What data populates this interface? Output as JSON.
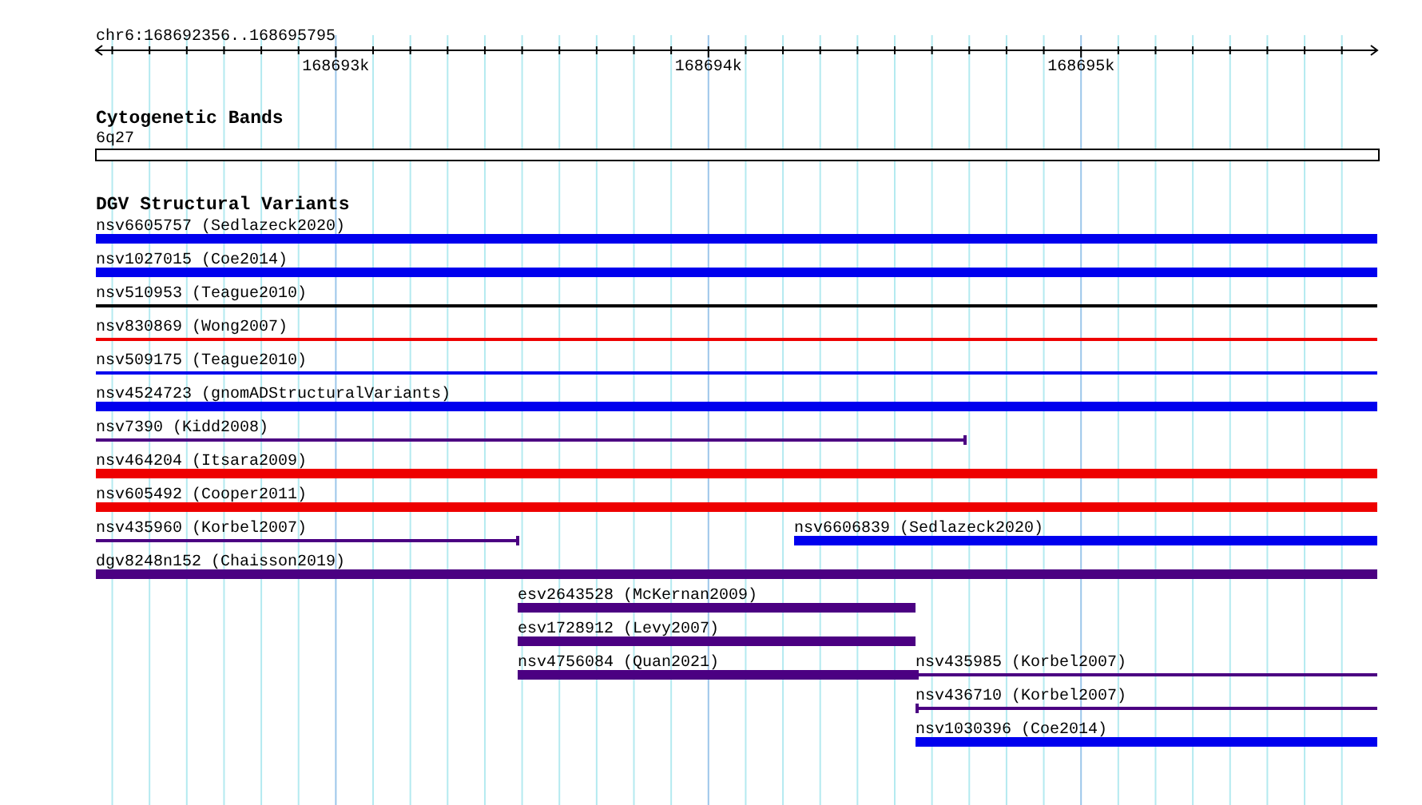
{
  "ruler": {
    "location": "chr6:168692356..168695795",
    "major_labels": [
      "168693k",
      "168694k",
      "168695k"
    ]
  },
  "cytogenetic_track": {
    "title": "Cytogenetic Bands",
    "band": "6q27"
  },
  "dgv_track": {
    "title": "DGV Structural Variants",
    "rows": [
      {
        "features": [
          {
            "label": "nsv6605757 (Sedlazeck2020)",
            "kind": "thick",
            "color": "#0000ee"
          }
        ]
      },
      {
        "features": [
          {
            "label": "nsv1027015 (Coe2014)",
            "kind": "thick",
            "color": "#0000ee"
          }
        ]
      },
      {
        "features": [
          {
            "label": "nsv510953 (Teague2010)",
            "kind": "thin",
            "color": "#000000"
          }
        ]
      },
      {
        "features": [
          {
            "label": "nsv830869 (Wong2007)",
            "kind": "thin",
            "color": "#ee0000"
          }
        ]
      },
      {
        "features": [
          {
            "label": "nsv509175 (Teague2010)",
            "kind": "thin",
            "color": "#0000ee"
          }
        ]
      },
      {
        "features": [
          {
            "label": "nsv4524723 (gnomADStructuralVariants)",
            "kind": "thick",
            "color": "#0000ee"
          }
        ]
      },
      {
        "features": [
          {
            "label": "nsv7390 (Kidd2008)",
            "kind": "thin",
            "color": "#4b0082"
          }
        ]
      },
      {
        "features": [
          {
            "label": "nsv464204 (Itsara2009)",
            "kind": "thick",
            "color": "#ee0000"
          }
        ]
      },
      {
        "features": [
          {
            "label": "nsv605492 (Cooper2011)",
            "kind": "thick",
            "color": "#ee0000"
          }
        ]
      },
      {
        "features": [
          {
            "label": "nsv435960 (Korbel2007)",
            "kind": "thin",
            "color": "#4b0082"
          },
          {
            "label": "nsv6606839 (Sedlazeck2020)",
            "kind": "thick",
            "color": "#0000ee"
          }
        ]
      },
      {
        "features": [
          {
            "label": "dgv8248n152 (Chaisson2019)",
            "kind": "thick",
            "color": "#4b0082"
          }
        ]
      },
      {
        "features": [
          {
            "label": "esv2643528 (McKernan2009)",
            "kind": "thick",
            "color": "#4b0082"
          }
        ]
      },
      {
        "features": [
          {
            "label": "esv1728912 (Levy2007)",
            "kind": "thick",
            "color": "#4b0082"
          }
        ]
      },
      {
        "features": [
          {
            "label": "nsv4756084 (Quan2021)",
            "kind": "thick",
            "color": "#4b0082"
          },
          {
            "label": "nsv435985 (Korbel2007)",
            "kind": "thin",
            "color": "#4b0082"
          }
        ]
      },
      {
        "features": [
          {
            "label": "nsv436710 (Korbel2007)",
            "kind": "thin",
            "color": "#4b0082"
          }
        ]
      },
      {
        "features": [
          {
            "label": "nsv1030396 (Coe2014)",
            "kind": "thick",
            "color": "#0000ee"
          }
        ]
      }
    ]
  }
}
